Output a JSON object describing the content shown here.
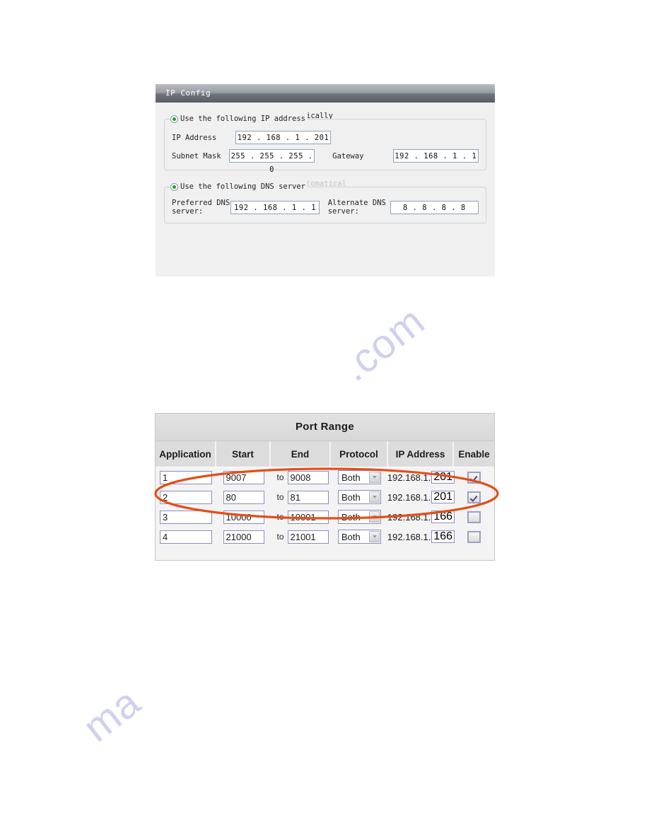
{
  "watermark": {
    "text_right": ".com",
    "text_left": "ma"
  },
  "ip_config": {
    "title": "IP Config",
    "obtain_ip_auto": {
      "label": "Obtain an IP address automatically",
      "selected": false
    },
    "use_following_ip": {
      "label": "Use the following IP address",
      "selected": true
    },
    "fields": {
      "ip_address_label": "IP Address",
      "ip_address_value": "192 . 168 .  1  . 201",
      "subnet_mask_label": "Subnet Mask",
      "subnet_mask_value": "255 . 255 . 255 .  0",
      "gateway_label": "Gateway",
      "gateway_value": "192 . 168 .  1  .  1"
    },
    "obtain_dns_auto": {
      "label": "Obtain DNS server address automatical",
      "selected": false,
      "disabled": true
    },
    "use_following_dns": {
      "label": "Use the following DNS server",
      "selected": true
    },
    "dns_fields": {
      "preferred_label": "Preferred DNS\nserver:",
      "preferred_value": "192 . 168 .  1  .  1",
      "alternate_label": "Alternate DNS\nserver:",
      "alternate_value": "8  .  8  .  8  .  8"
    }
  },
  "port_range": {
    "title": "Port Range",
    "columns": [
      "Application",
      "Start",
      "End",
      "Protocol",
      "IP Address",
      "Enable"
    ],
    "to_label": "to",
    "ip_prefix": "192.168.1.",
    "rows": [
      {
        "application": "1",
        "start": "9007",
        "end": "9008",
        "protocol": "Both",
        "ip_prefix": "192.168.1.",
        "ip_last": "201",
        "enabled": true
      },
      {
        "application": "2",
        "start": "80",
        "end": "81",
        "protocol": "Both",
        "ip_prefix": "192.168.1.",
        "ip_last": "201",
        "enabled": true
      },
      {
        "application": "3",
        "start": "10000",
        "end": "10001",
        "protocol": "Both",
        "ip_prefix": "192.168.1.",
        "ip_last": "166",
        "enabled": false
      },
      {
        "application": "4",
        "start": "21000",
        "end": "21001",
        "protocol": "Both",
        "ip_prefix": "192.168.1.",
        "ip_last": "166",
        "enabled": false
      }
    ]
  },
  "annotation": {
    "color": "#e24f18",
    "shape": "ellipse",
    "covers_rows": [
      "1",
      "2"
    ]
  }
}
